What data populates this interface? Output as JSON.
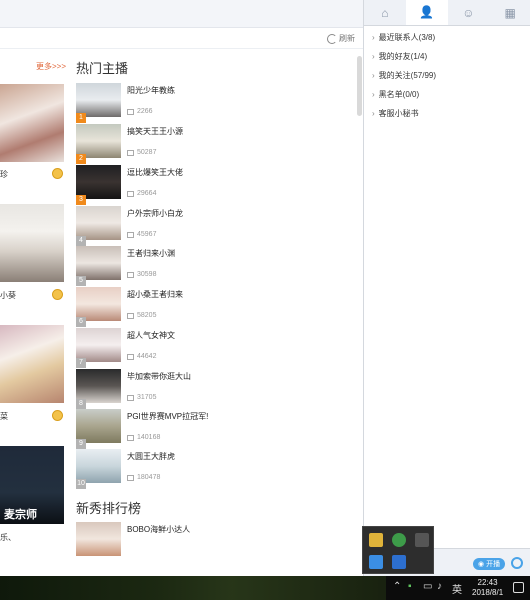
{
  "main": {
    "refresh_label": "刷新",
    "more_label": "更多>>>",
    "hot_title": "热门主播",
    "new_title": "新秀排行榜",
    "left_cards": [
      {
        "name": "珍"
      },
      {
        "name": "小葵"
      },
      {
        "name": "菜"
      },
      {
        "name": "乐、"
      }
    ],
    "left_banner_text": "麦宗师",
    "hot_list": [
      {
        "rank": "1",
        "name": "阳光少年教练",
        "views": "2266"
      },
      {
        "rank": "2",
        "name": "搞笑天王王小源",
        "views": "50287"
      },
      {
        "rank": "3",
        "name": "逗比爆笑王大佬",
        "views": "29664"
      },
      {
        "rank": "4",
        "name": "户外宗师小白龙",
        "views": "45967"
      },
      {
        "rank": "5",
        "name": "王者归来小渊",
        "views": "30598"
      },
      {
        "rank": "6",
        "name": "超小桑王者归来",
        "views": "58205"
      },
      {
        "rank": "7",
        "name": "超人气女神文",
        "views": "44642"
      },
      {
        "rank": "8",
        "name": "毕加索带你逛大山",
        "views": "31705"
      },
      {
        "rank": "9",
        "name": "PGI世界赛MVP拉冠军!",
        "views": "140168"
      },
      {
        "rank": "10",
        "name": "大圆王大胖虎",
        "views": "180478"
      }
    ],
    "new_list": [
      {
        "name": "BOBO海鲜小达人"
      }
    ]
  },
  "panel": {
    "groups": [
      {
        "label": "最近联系人(3/8)"
      },
      {
        "label": "我的好友(1/4)"
      },
      {
        "label": "我的关注(57/99)"
      },
      {
        "label": "黑名单(0/0)"
      },
      {
        "label": "客服小秘书"
      }
    ],
    "open_label": "开播"
  },
  "taskbar": {
    "ime": "英",
    "time": "22:43",
    "date": "2018/8/1"
  },
  "colors": {
    "accent": "#3b8ee4",
    "orange": "#e0673a",
    "rank_top": "#f08a1c"
  }
}
